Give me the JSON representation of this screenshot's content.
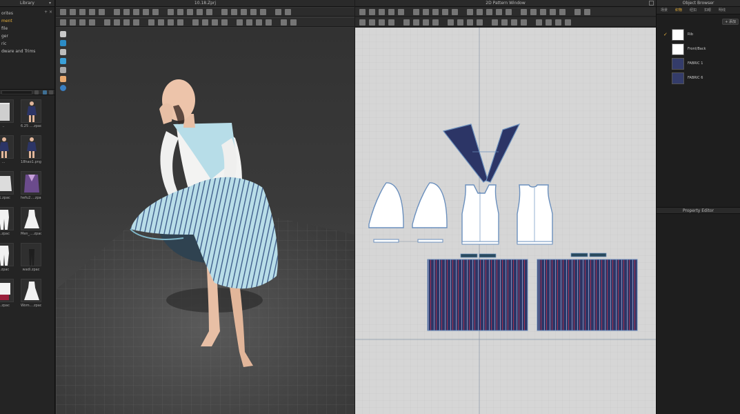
{
  "library": {
    "title": "Library",
    "tree": [
      {
        "label": "orites",
        "active": false
      },
      {
        "label": "ment",
        "active": true
      },
      {
        "label": "file",
        "active": false
      },
      {
        "label": "ger",
        "active": false
      },
      {
        "label": "ric",
        "active": false
      },
      {
        "label": "dware and Trims",
        "active": false
      }
    ],
    "search_placeholder": "",
    "items": [
      {
        "caption": "..",
        "kind": "book"
      },
      {
        "caption": "6.25 ....zpac",
        "kind": "figure-blue"
      },
      {
        "caption": "...",
        "kind": "figure-blue"
      },
      {
        "caption": "18hao1.png",
        "kind": "figure-blue"
      },
      {
        "caption": "g1.zpac",
        "kind": "shirt-white"
      },
      {
        "caption": "hefu2....zpac",
        "kind": "kimono"
      },
      {
        "caption": "....zpac",
        "kind": "suit-white"
      },
      {
        "caption": "Men_....zpac",
        "kind": "dress-white"
      },
      {
        "caption": "...zpac",
        "kind": "suit-white"
      },
      {
        "caption": "wadi.zpac",
        "kind": "figure-dark"
      },
      {
        "caption": "....zpac",
        "kind": "shirt-red"
      },
      {
        "caption": "Wom....zpac",
        "kind": "dress-white"
      }
    ]
  },
  "view3d": {
    "title": "10.18.Zprj"
  },
  "pattern_window": {
    "title": "2D Pattern Window"
  },
  "object_browser": {
    "title": "Object Browser",
    "tabs": [
      "场景",
      "织物",
      "纽扣",
      "扣眼",
      "明线"
    ],
    "active_tab": 1,
    "add_label": "+ 添加",
    "fabrics": [
      {
        "name": "Rib",
        "color": "#ffffff",
        "checked": true
      },
      {
        "name": "Front/Back",
        "color": "#ffffff",
        "checked": false
      },
      {
        "name": "FABRIC 1",
        "color": "#343c6a",
        "checked": false
      },
      {
        "name": "FABRIC 6",
        "color": "#343c6a",
        "checked": false
      }
    ]
  },
  "property_editor": {
    "title": "Property Editor"
  },
  "colors": {
    "accent": "#e9b13a",
    "navy": "#2c3566",
    "pattern_outline": "#6a8fbd",
    "skirt_light": "#b7dde8"
  }
}
